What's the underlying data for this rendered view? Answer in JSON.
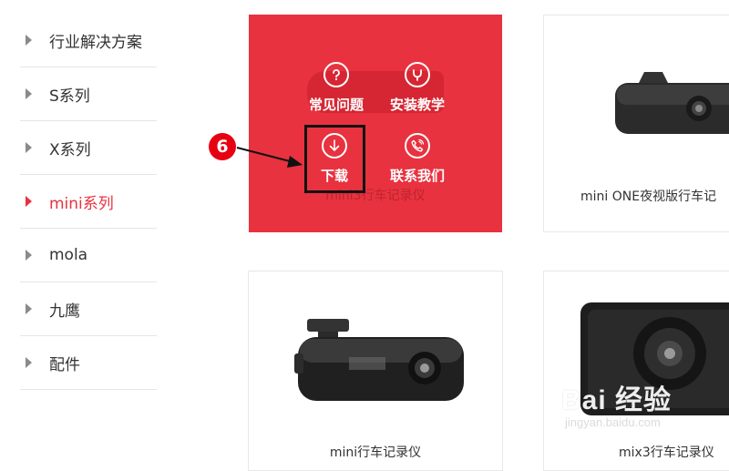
{
  "sidebar": {
    "items": [
      {
        "label": "行业解决方案"
      },
      {
        "label": "S系列"
      },
      {
        "label": "X系列"
      },
      {
        "label": "mini系列"
      },
      {
        "label": "mola"
      },
      {
        "label": "九鹰"
      },
      {
        "label": "配件"
      }
    ],
    "active_index": 3
  },
  "products": [
    {
      "name": "mini3行车记录仪"
    },
    {
      "name": "mini ONE夜视版行车记"
    },
    {
      "name": "mini行车记录仪"
    },
    {
      "name": "mix3行车记录仪"
    }
  ],
  "overlay": {
    "faq_label": "常见问题",
    "install_label": "安装教学",
    "download_label": "下载",
    "contact_label": "联系我们"
  },
  "annotation": {
    "step_number": "6"
  },
  "watermark": {
    "brand": "Bai 经验",
    "url": "jingyan.baidu.com"
  },
  "colors": {
    "accent": "#e8323f",
    "badge": "#e60012"
  }
}
